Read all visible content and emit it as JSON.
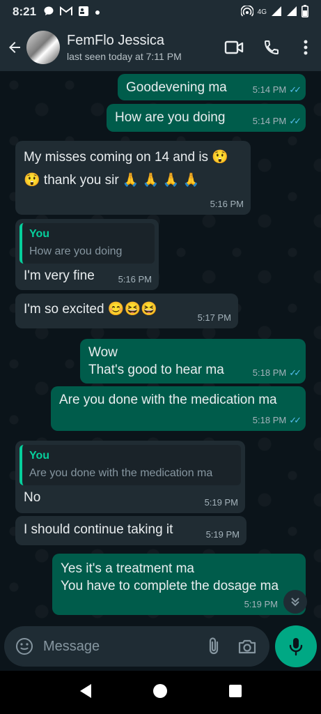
{
  "status_bar": {
    "time": "8:21",
    "notification_icons": [
      "chat-bubble-icon",
      "gmail-icon",
      "contact-card-icon",
      "dot-icon"
    ],
    "right_icons": [
      "hotspot-icon",
      "signal-icon",
      "battery-icon"
    ],
    "network": "4G"
  },
  "header": {
    "contact_name": "FemFlo Jessica",
    "last_seen": "last seen today at 7:11 PM"
  },
  "messages": [
    {
      "dir": "out",
      "lines": [
        "Goodevening ma"
      ],
      "time": "5:14 PM",
      "read": true
    },
    {
      "dir": "out",
      "lines": [
        "How are you doing"
      ],
      "time": "5:14 PM",
      "read": true
    },
    {
      "dir": "in",
      "lines": [
        "My misses coming on  14 and is 😲",
        "😲 thank you sir 🙏 🙏 🙏 🙏"
      ],
      "time": "5:16 PM"
    },
    {
      "dir": "in",
      "quote_author": "You",
      "quote_text": "How are you doing",
      "lines": [
        "I'm very fine"
      ],
      "time": "5:16 PM"
    },
    {
      "dir": "in",
      "lines": [
        "I'm so excited 😊😆😆"
      ],
      "time": "5:17 PM"
    },
    {
      "dir": "out",
      "lines": [
        "Wow",
        "That's good to hear ma"
      ],
      "time": "5:18 PM",
      "read": true
    },
    {
      "dir": "out",
      "lines": [
        "Are you done with the medication ma"
      ],
      "time": "5:18 PM",
      "read": true
    },
    {
      "dir": "in",
      "quote_author": "You",
      "quote_text": "Are you done with the medication ma",
      "lines": [
        "No"
      ],
      "time": "5:19 PM"
    },
    {
      "dir": "in",
      "lines": [
        "I should continue taking it"
      ],
      "time": "5:19 PM"
    },
    {
      "dir": "out",
      "lines": [
        "Yes it's a treatment ma",
        "You have to complete the dosage ma"
      ],
      "time": "5:19 PM"
    }
  ],
  "composer": {
    "placeholder": "Message"
  },
  "colors": {
    "outgoing_bubble": "#005c4b",
    "incoming_bubble": "#202c33",
    "accent": "#00a884",
    "read_ticks": "#53bdeb",
    "quote_accent": "#06cf9c"
  }
}
